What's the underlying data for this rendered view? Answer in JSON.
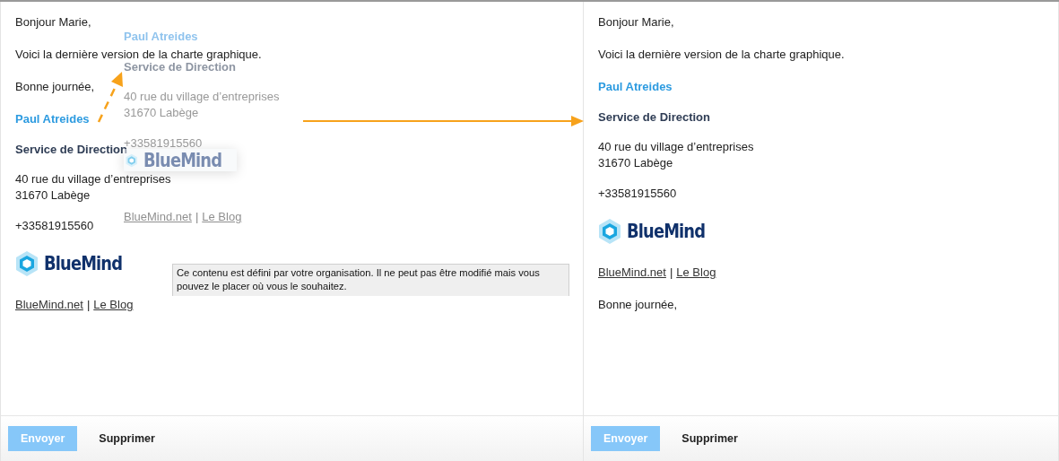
{
  "panes": [
    {
      "content": [
        {
          "kind": "paragraph",
          "text": "Bonjour Marie,"
        },
        {
          "kind": "paragraph",
          "text": "Voici la dernière version de la charte graphique."
        },
        {
          "kind": "paragraph",
          "text": "Bonne journée,"
        },
        {
          "kind": "signature",
          "name": "Paul Atreides",
          "department": "Service de Direction",
          "address_lines": [
            "40 rue du village d’entreprises",
            "31670 Labège"
          ],
          "phone": "+33581915560",
          "logo_text": "BlueMind",
          "links": [
            "BlueMind.net",
            "Le Blog"
          ],
          "separator": "|"
        }
      ],
      "drag_preview": {
        "name": "Paul Atreides",
        "department": "Service de Direction",
        "address_lines": [
          "40 rue du village d’entreprises",
          "31670 Labège"
        ],
        "phone": "+33581915560",
        "logo_text": "BlueMind",
        "links": [
          "BlueMind.net",
          "Le Blog"
        ],
        "separator": "|"
      },
      "tooltip": "Ce contenu est défini par votre organisation. Il ne peut pas être modifié mais vous pouvez le placer où vous le souhaitez.",
      "buttons": [
        {
          "label": "Envoyer",
          "kind": "primary",
          "disabled": true
        },
        {
          "label": "Supprimer",
          "kind": "plain",
          "disabled": false
        }
      ]
    },
    {
      "content": [
        {
          "kind": "paragraph",
          "text": "Bonjour Marie,"
        },
        {
          "kind": "paragraph",
          "text": "Voici la dernière version de la charte graphique."
        },
        {
          "kind": "signature",
          "name": "Paul Atreides",
          "department": "Service de Direction",
          "address_lines": [
            "40 rue du village d’entreprises",
            "31670 Labège"
          ],
          "phone": "+33581915560",
          "logo_text": "BlueMind",
          "links": [
            "BlueMind.net",
            "Le Blog"
          ],
          "separator": "|"
        },
        {
          "kind": "paragraph",
          "text": "Bonne journée,"
        }
      ],
      "buttons": [
        {
          "label": "Envoyer",
          "kind": "primary",
          "disabled": true
        },
        {
          "label": "Supprimer",
          "kind": "plain",
          "disabled": false
        }
      ]
    }
  ]
}
